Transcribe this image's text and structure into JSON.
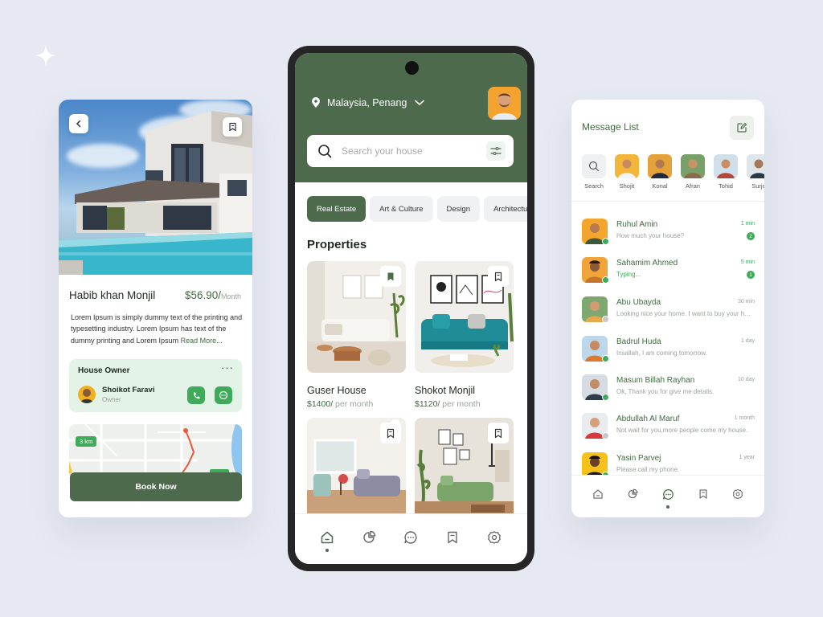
{
  "left_screen": {
    "property_title": "Habib khan Monjil",
    "price": "$56.90/",
    "price_unit": "Month",
    "description": "Lorem Ipsum is simply dummy text of the printing and typesetting industry. Lorem Ipsum has text of the dummy printing and Lorem Ipsum",
    "read_more": "Read More...",
    "owner_section_title": "House Owner",
    "owner_menu": "···",
    "owner_name": "Shoikot Faravi",
    "owner_role": "Owner",
    "map_distance": "3 km",
    "book_button": "Book Now"
  },
  "phone": {
    "location": "Malaysia, Penang",
    "search_placeholder": "Search your house",
    "categories": [
      "Real Estate",
      "Art & Culture",
      "Design",
      "Architecture"
    ],
    "active_category": "Real Estate",
    "section_title": "Properties",
    "properties": [
      {
        "name": "Guser House",
        "price": "$1400/",
        "unit": " per month",
        "bookmarked": true
      },
      {
        "name": "Shokot Monjil",
        "price": "$1120/",
        "unit": " per month",
        "bookmarked": false
      },
      {
        "name": "",
        "price": "",
        "unit": "",
        "bookmarked": false
      },
      {
        "name": "",
        "price": "",
        "unit": "",
        "bookmarked": false
      }
    ],
    "tabs": [
      "home-icon",
      "chart-icon",
      "chat-icon",
      "bookmark-icon",
      "settings-icon"
    ],
    "active_tab": "home-icon"
  },
  "right_screen": {
    "title": "Message List",
    "stories": [
      "Search",
      "Shojit",
      "Konal",
      "Afran",
      "Tohid",
      "Surjo"
    ],
    "messages": [
      {
        "name": "Ruhul Amin",
        "preview": "How much your house?",
        "time": "1 min",
        "unread": "2",
        "online": true
      },
      {
        "name": "Sahamim Ahmed",
        "preview": "Typing...",
        "time": "5 min",
        "unread": "1",
        "online": true
      },
      {
        "name": "Abu Ubayda",
        "preview": "Looking nice your home. I want to buy your home.",
        "time": "30 min",
        "unread": "",
        "online": false
      },
      {
        "name": "Badrul Huda",
        "preview": "Insallah, I am coming tomorrow.",
        "time": "1 day",
        "unread": "",
        "online": true
      },
      {
        "name": "Masum Billah Rayhan",
        "preview": "Ok, Thank you for give me details.",
        "time": "10 day",
        "unread": "",
        "online": true
      },
      {
        "name": "Abdullah Al Maruf",
        "preview": "Not wait for you,more people come my house.",
        "time": "1 month",
        "unread": "",
        "online": false
      },
      {
        "name": "Yasin Parvej",
        "preview": "Please call my phone.",
        "time": "1 year",
        "unread": "",
        "online": true
      }
    ],
    "tabs": [
      "home-icon",
      "chart-icon",
      "chat-icon",
      "bookmark-icon",
      "settings-icon"
    ],
    "active_tab": "chat-icon"
  },
  "colors": {
    "brand": "#4d6b4c",
    "accent_green": "#3faa5a",
    "background": "#e6e9f2"
  }
}
